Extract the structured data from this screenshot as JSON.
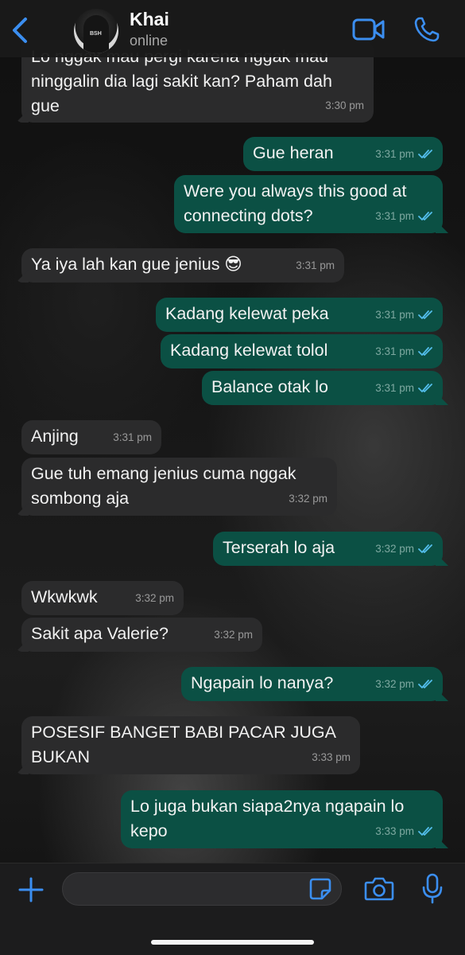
{
  "header": {
    "back_icon": "chevron-left-icon",
    "contact_name": "Khai",
    "contact_status": "online",
    "avatar_badge": "BSH",
    "video_icon": "video-camera-icon",
    "call_icon": "phone-icon",
    "accent_color": "#3b8ef0"
  },
  "messages": [
    {
      "dir": "in",
      "text": "Lo nggak mau pergi karena nggak mau ninggalin dia lagi sakit kan? Paham dah gue",
      "time": "3:30 pm"
    },
    {
      "dir": "out",
      "text": "Gue heran",
      "time": "3:31 pm",
      "read": true
    },
    {
      "dir": "out",
      "text": "Were you always this good at connecting dots?",
      "time": "3:31 pm",
      "read": true
    },
    {
      "dir": "in",
      "text": "Ya iya lah kan gue jenius 😎",
      "time": "3:31 pm"
    },
    {
      "dir": "out",
      "text": "Kadang kelewat peka",
      "time": "3:31 pm",
      "read": true
    },
    {
      "dir": "out",
      "text": "Kadang kelewat tolol",
      "time": "3:31 pm",
      "read": true
    },
    {
      "dir": "out",
      "text": "Balance otak lo",
      "time": "3:31 pm",
      "read": true
    },
    {
      "dir": "in",
      "text": "Anjing",
      "time": "3:31 pm"
    },
    {
      "dir": "in",
      "text": "Gue tuh emang jenius cuma nggak sombong aja",
      "time": "3:32 pm"
    },
    {
      "dir": "out",
      "text": "Terserah lo aja",
      "time": "3:32 pm",
      "read": true
    },
    {
      "dir": "in",
      "text": "Wkwkwk",
      "time": "3:32 pm"
    },
    {
      "dir": "in",
      "text": "Sakit apa Valerie?",
      "time": "3:32 pm"
    },
    {
      "dir": "out",
      "text": "Ngapain lo nanya?",
      "time": "3:32 pm",
      "read": true
    },
    {
      "dir": "in",
      "text": "POSESIF BANGET BABI PACAR JUGA BUKAN",
      "time": "3:33 pm"
    },
    {
      "dir": "out",
      "text": "Lo juga bukan siapa2nya ngapain lo kepo",
      "time": "3:33 pm",
      "read": true
    }
  ],
  "colors": {
    "incoming_bubble": "#2b2b2c",
    "outgoing_bubble": "#0b5044",
    "read_ticks": "#53bdeb"
  },
  "input_bar": {
    "placeholder": "",
    "plus_icon": "plus-icon",
    "sticker_icon": "sticker-icon",
    "camera_icon": "camera-icon",
    "mic_icon": "microphone-icon"
  }
}
